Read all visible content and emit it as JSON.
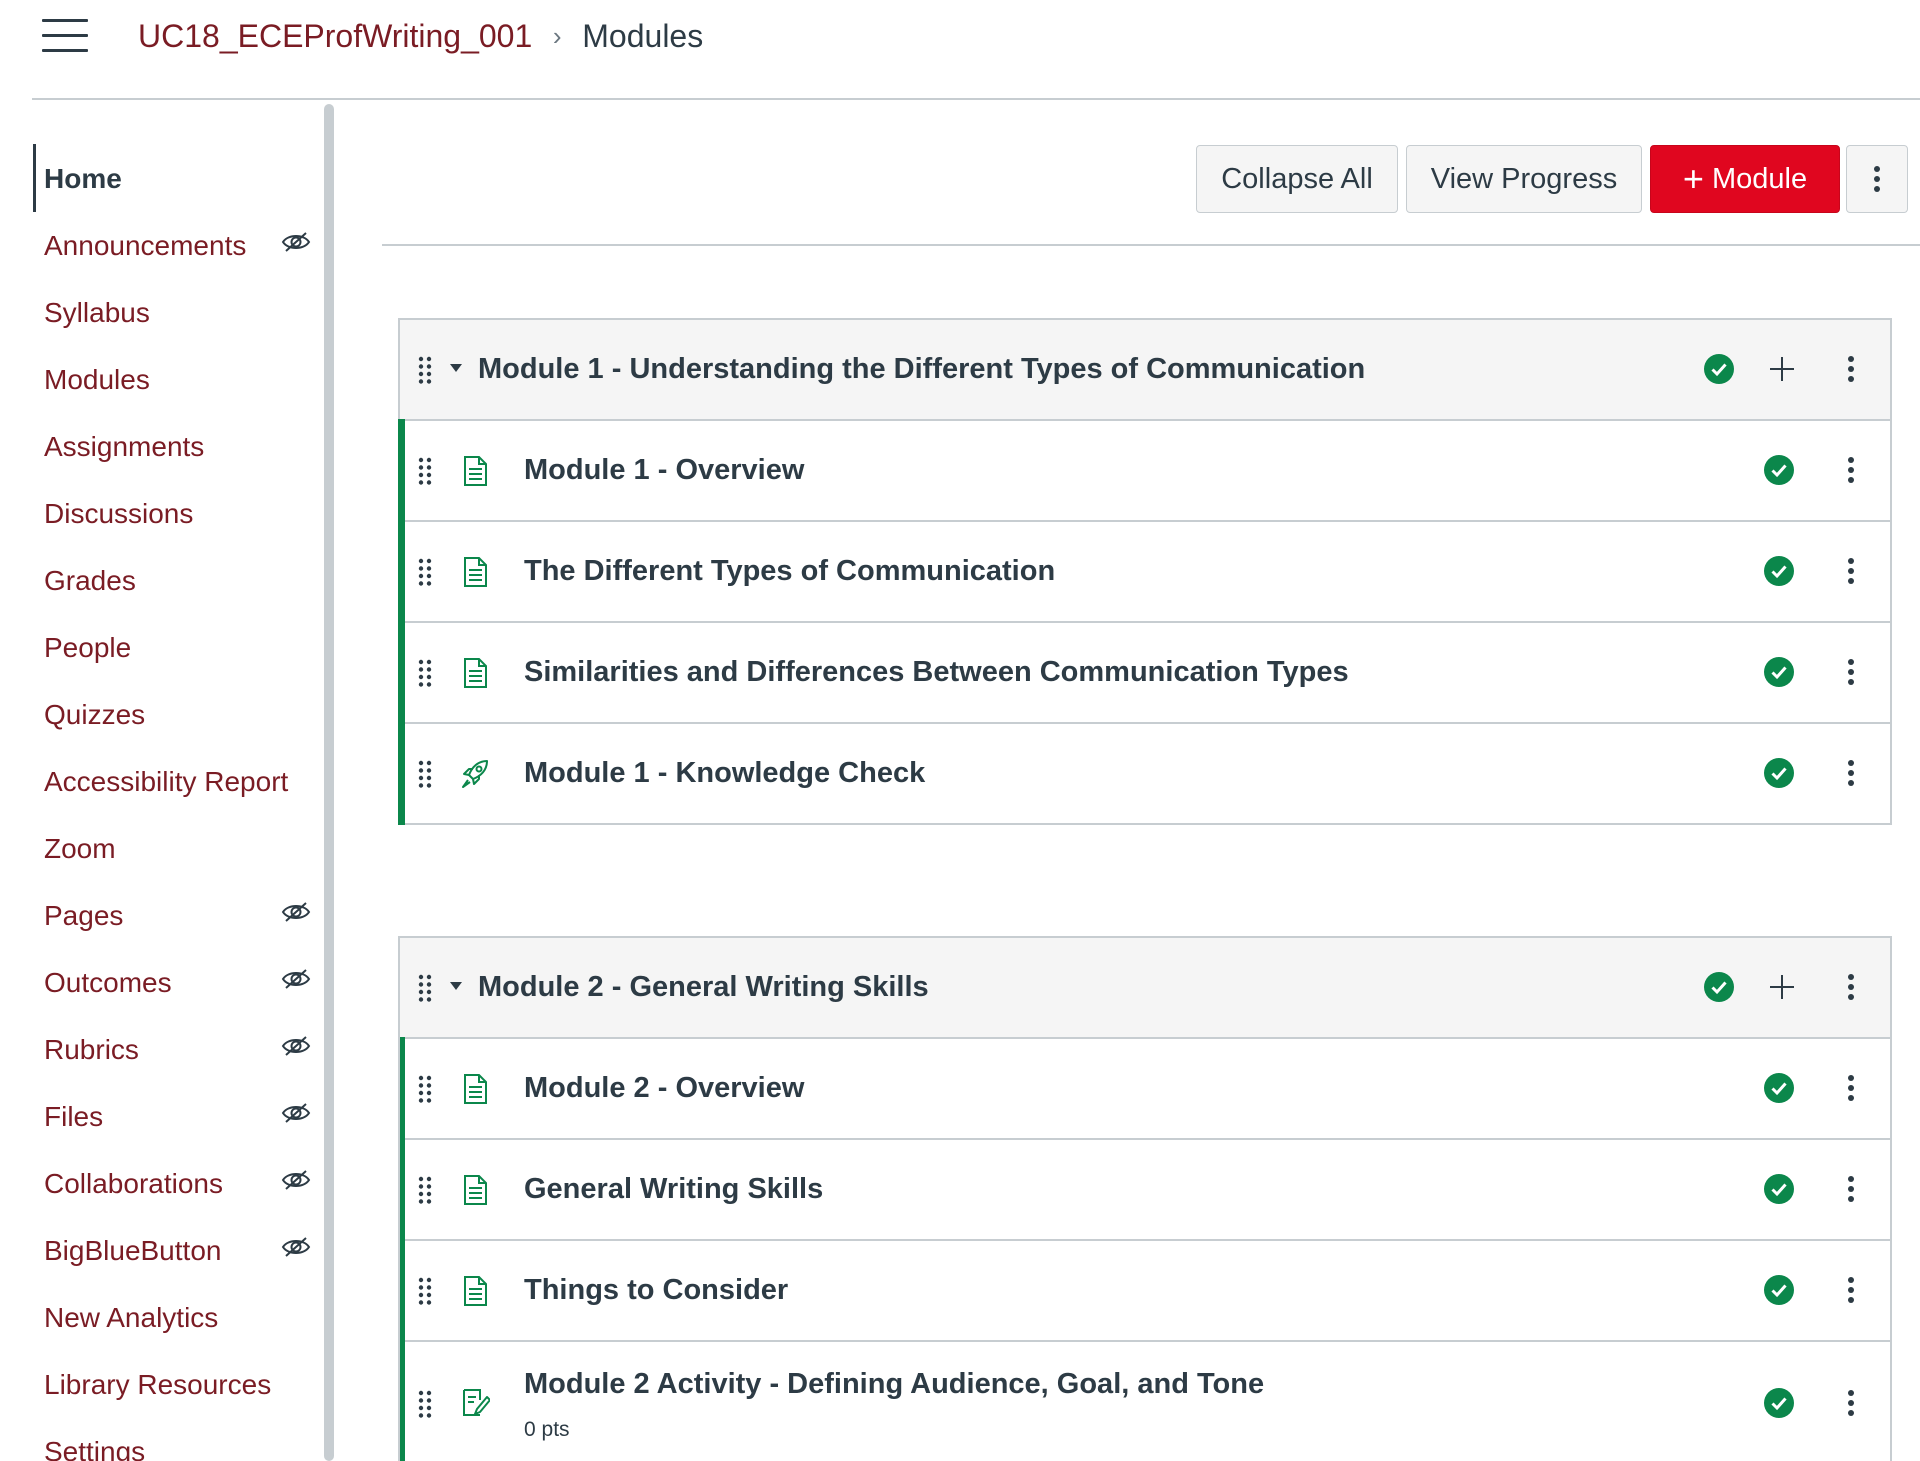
{
  "header": {
    "course": "UC18_ECEProfWriting_001",
    "separator": "›",
    "current": "Modules"
  },
  "nav": {
    "items": [
      {
        "label": "Home",
        "active": true,
        "hidden": false
      },
      {
        "label": "Announcements",
        "active": false,
        "hidden": true
      },
      {
        "label": "Syllabus",
        "active": false,
        "hidden": false
      },
      {
        "label": "Modules",
        "active": false,
        "hidden": false
      },
      {
        "label": "Assignments",
        "active": false,
        "hidden": false
      },
      {
        "label": "Discussions",
        "active": false,
        "hidden": false
      },
      {
        "label": "Grades",
        "active": false,
        "hidden": false
      },
      {
        "label": "People",
        "active": false,
        "hidden": false
      },
      {
        "label": "Quizzes",
        "active": false,
        "hidden": false
      },
      {
        "label": "Accessibility Report",
        "active": false,
        "hidden": false
      },
      {
        "label": "Zoom",
        "active": false,
        "hidden": false
      },
      {
        "label": "Pages",
        "active": false,
        "hidden": true
      },
      {
        "label": "Outcomes",
        "active": false,
        "hidden": true
      },
      {
        "label": "Rubrics",
        "active": false,
        "hidden": true
      },
      {
        "label": "Files",
        "active": false,
        "hidden": true
      },
      {
        "label": "Collaborations",
        "active": false,
        "hidden": true
      },
      {
        "label": "BigBlueButton",
        "active": false,
        "hidden": true
      },
      {
        "label": "New Analytics",
        "active": false,
        "hidden": false
      },
      {
        "label": "Library Resources",
        "active": false,
        "hidden": false
      },
      {
        "label": "Settings",
        "active": false,
        "hidden": false
      }
    ]
  },
  "toolbar": {
    "collapse_all": "Collapse All",
    "view_progress": "View Progress",
    "add_module": "Module",
    "add_module_plus": "+"
  },
  "modules": [
    {
      "title": "Module 1 - Understanding the Different Types of Communication",
      "published": true,
      "items": [
        {
          "title": "Module 1 - Overview",
          "type": "page-icon",
          "published": true
        },
        {
          "title": "The Different Types of Communication",
          "type": "page-icon",
          "published": true
        },
        {
          "title": "Similarities and Differences Between Communication Types",
          "type": "page-icon",
          "published": true
        },
        {
          "title": "Module 1 - Knowledge Check",
          "type": "quiz-rocket-icon",
          "published": true
        }
      ]
    },
    {
      "title": "Module 2 - General Writing Skills",
      "published": true,
      "items": [
        {
          "title": "Module 2 - Overview",
          "type": "page-icon",
          "published": true
        },
        {
          "title": "General Writing Skills",
          "type": "page-icon",
          "published": true
        },
        {
          "title": "Things to Consider",
          "type": "page-icon",
          "published": true
        },
        {
          "title": "Module 2 Activity - Defining Audience, Goal, and Tone",
          "subtitle": "0 pts",
          "type": "assignment-icon",
          "published": true
        }
      ]
    }
  ],
  "colors": {
    "link": "#7a1c24",
    "text": "#2d3b45",
    "primary": "#e0061f",
    "published": "#0b874b",
    "border": "#c7cdd1"
  }
}
